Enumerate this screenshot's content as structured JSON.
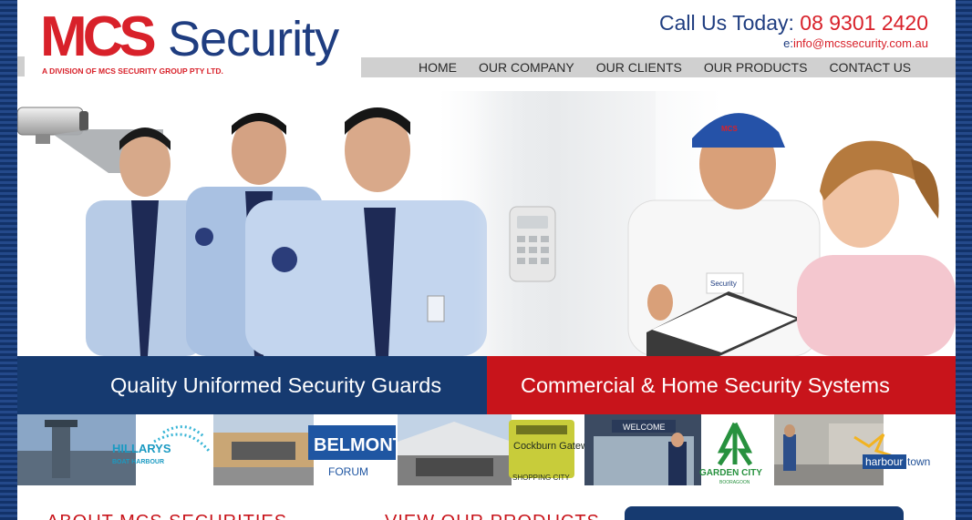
{
  "header": {
    "logo_mcs": "MCS",
    "logo_security": "Security",
    "logo_tagline": "A DIVISION OF MCS SECURITY GROUP PTY LTD.",
    "call_label": "Call Us Today: ",
    "phone": "08 9301 2420",
    "email_label": "e:",
    "email": "info@mcssecurity.com.au"
  },
  "nav": {
    "items": [
      {
        "label": "HOME"
      },
      {
        "label": "OUR COMPANY"
      },
      {
        "label": "OUR CLIENTS"
      },
      {
        "label": "OUR PRODUCTS"
      },
      {
        "label": "CONTACT US"
      }
    ]
  },
  "hero": {
    "cap_logo": "MCS",
    "shirt_logo": "Security"
  },
  "banners": {
    "left": "Quality Uniformed Security Guards",
    "right": "Commercial & Home Security Systems"
  },
  "clients": [
    {
      "name": "HILLARYS",
      "sub": "BOAT HARBOUR"
    },
    {
      "name": "BELMONT",
      "sub": "FORUM"
    },
    {
      "name": "Cockburn Gateway",
      "sub": "SHOPPING CITY"
    },
    {
      "name": "GARDEN CITY",
      "sub": "BOORAGOON",
      "sign": "WELCOME"
    },
    {
      "name": "harbour",
      "sub": "town"
    }
  ],
  "bottom": {
    "about": "ABOUT MCS SECURITIES",
    "products": "VIEW OUR PRODUCTS"
  },
  "colors": {
    "brand_red": "#d8212a",
    "brand_blue": "#1f3d80",
    "banner_blue": "#163a70",
    "banner_red": "#c8141b",
    "nav_gray": "#d0d0d0"
  }
}
